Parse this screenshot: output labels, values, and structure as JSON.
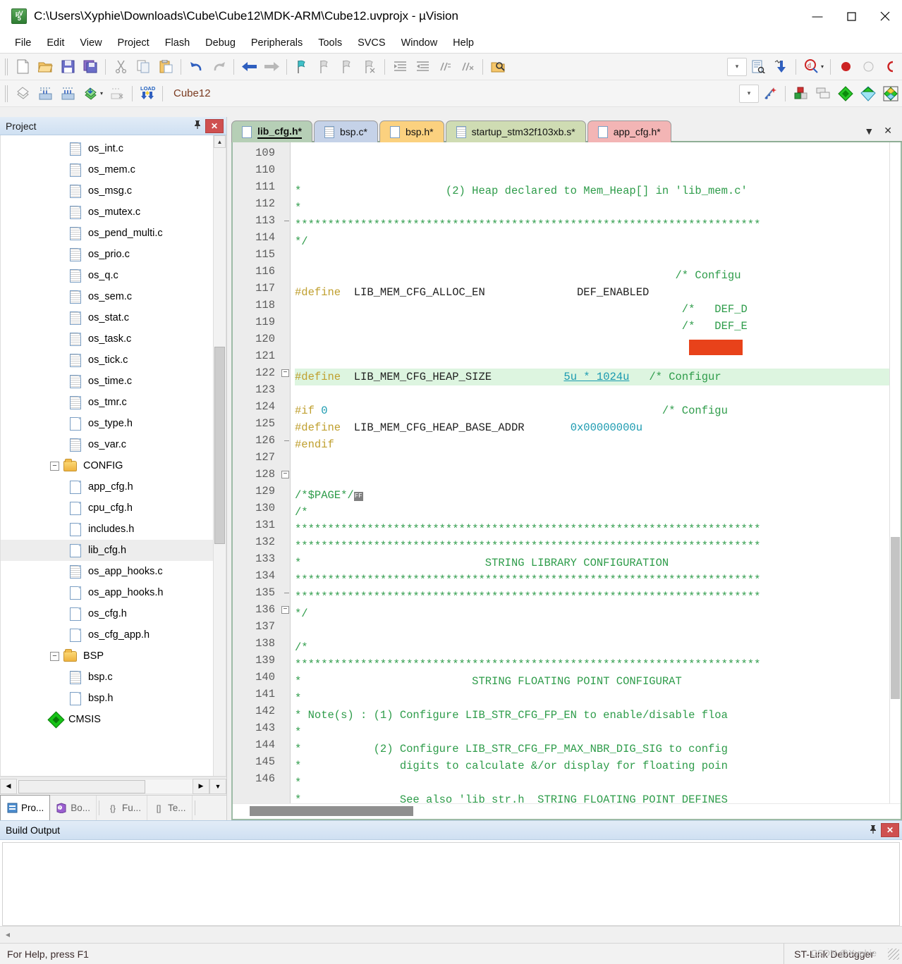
{
  "window": {
    "title": "C:\\Users\\Xyphie\\Downloads\\Cube\\Cube12\\MDK-ARM\\Cube12.uvprojx - µVision",
    "app_icon_top": "µV",
    "app_icon_bottom": "5",
    "minimize": "—",
    "maximize": "▢",
    "close": "✕"
  },
  "menu": {
    "items": [
      "File",
      "Edit",
      "View",
      "Project",
      "Flash",
      "Debug",
      "Peripherals",
      "Tools",
      "SVCS",
      "Window",
      "Help"
    ]
  },
  "toolbar1": {
    "buttons": [
      {
        "name": "new-file-icon",
        "glyph": "📄"
      },
      {
        "name": "open-file-icon",
        "glyph": "📂"
      },
      {
        "name": "save-icon",
        "glyph": "💾"
      },
      {
        "name": "save-all-icon",
        "glyph": "🗂"
      },
      {
        "name": "cut-icon",
        "glyph": "✂"
      },
      {
        "name": "copy-icon",
        "glyph": "⧉"
      },
      {
        "name": "paste-icon",
        "glyph": "📋"
      },
      {
        "name": "undo-icon",
        "glyph": "↶"
      },
      {
        "name": "redo-icon",
        "glyph": "↷"
      },
      {
        "name": "navigate-back-icon",
        "glyph": "←"
      },
      {
        "name": "navigate-forward-icon",
        "glyph": "→"
      },
      {
        "name": "bookmark-toggle-icon",
        "glyph": "⚑"
      },
      {
        "name": "bookmark-prev-icon",
        "glyph": "⚐"
      },
      {
        "name": "bookmark-next-icon",
        "glyph": "⚐"
      },
      {
        "name": "bookmark-clear-icon",
        "glyph": "⚐"
      },
      {
        "name": "indent-icon",
        "glyph": "⇥"
      },
      {
        "name": "outdent-icon",
        "glyph": "⇤"
      },
      {
        "name": "comment-icon",
        "glyph": "//"
      },
      {
        "name": "uncomment-icon",
        "glyph": "//"
      },
      {
        "name": "find-in-files-icon",
        "glyph": "🔍"
      }
    ],
    "right_buttons": [
      {
        "name": "configure-combo-icon",
        "glyph": "⌄"
      },
      {
        "name": "config-wizard-icon",
        "glyph": "📝"
      },
      {
        "name": "download-icon",
        "glyph": "⬇"
      },
      {
        "name": "debug-session-icon",
        "glyph": "Q"
      },
      {
        "name": "debug-dropdown-icon",
        "glyph": "▾"
      },
      {
        "name": "insert-breakpoint-icon",
        "glyph": "⬤"
      },
      {
        "name": "disable-breakpoint-icon",
        "glyph": "⬡"
      },
      {
        "name": "kill-breakpoints-icon",
        "glyph": "◖"
      }
    ]
  },
  "toolbar2": {
    "buttons": [
      {
        "name": "translate-icon",
        "glyph": "◈"
      },
      {
        "name": "build-icon",
        "glyph": "▥"
      },
      {
        "name": "rebuild-icon",
        "glyph": "▦"
      },
      {
        "name": "batch-build-icon",
        "glyph": "◆"
      },
      {
        "name": "batch-build-dropdown-icon",
        "glyph": "▾"
      },
      {
        "name": "stop-build-icon",
        "glyph": "▧"
      },
      {
        "name": "load-icon",
        "glyph": "LOAD"
      }
    ],
    "target_label": "Cube12",
    "right_buttons": [
      {
        "name": "target-options-icon",
        "glyph": "⌄"
      },
      {
        "name": "magic-wand-icon",
        "glyph": "✨"
      },
      {
        "name": "manage-project-items-icon",
        "glyph": "▣"
      },
      {
        "name": "multi-project-icon",
        "glyph": "❐"
      },
      {
        "name": "pack-installer-icon",
        "glyph": "◆"
      },
      {
        "name": "manage-rte-icon",
        "glyph": "◇"
      },
      {
        "name": "select-software-packs-icon",
        "glyph": "◈"
      }
    ]
  },
  "project_panel": {
    "title": "Project",
    "pin": "📌",
    "close": "✕",
    "tree": [
      {
        "label": "os_int.c",
        "indent": 3,
        "icon": "c-file",
        "selected": false,
        "expander": null
      },
      {
        "label": "os_mem.c",
        "indent": 3,
        "icon": "c-file",
        "selected": false,
        "expander": null
      },
      {
        "label": "os_msg.c",
        "indent": 3,
        "icon": "c-file",
        "selected": false,
        "expander": null
      },
      {
        "label": "os_mutex.c",
        "indent": 3,
        "icon": "c-file",
        "selected": false,
        "expander": null
      },
      {
        "label": "os_pend_multi.c",
        "indent": 3,
        "icon": "c-file",
        "selected": false,
        "expander": null
      },
      {
        "label": "os_prio.c",
        "indent": 3,
        "icon": "c-file",
        "selected": false,
        "expander": null
      },
      {
        "label": "os_q.c",
        "indent": 3,
        "icon": "c-file",
        "selected": false,
        "expander": null
      },
      {
        "label": "os_sem.c",
        "indent": 3,
        "icon": "c-file",
        "selected": false,
        "expander": null
      },
      {
        "label": "os_stat.c",
        "indent": 3,
        "icon": "c-file",
        "selected": false,
        "expander": null
      },
      {
        "label": "os_task.c",
        "indent": 3,
        "icon": "c-file",
        "selected": false,
        "expander": null
      },
      {
        "label": "os_tick.c",
        "indent": 3,
        "icon": "c-file",
        "selected": false,
        "expander": null
      },
      {
        "label": "os_time.c",
        "indent": 3,
        "icon": "c-file",
        "selected": false,
        "expander": null
      },
      {
        "label": "os_tmr.c",
        "indent": 3,
        "icon": "c-file",
        "selected": false,
        "expander": null
      },
      {
        "label": "os_type.h",
        "indent": 3,
        "icon": "h-file",
        "selected": false,
        "expander": null
      },
      {
        "label": "os_var.c",
        "indent": 3,
        "icon": "c-file",
        "selected": false,
        "expander": null
      },
      {
        "label": "CONFIG",
        "indent": 2,
        "icon": "folder",
        "selected": false,
        "expander": "−"
      },
      {
        "label": "app_cfg.h",
        "indent": 3,
        "icon": "h-file",
        "selected": false,
        "expander": null
      },
      {
        "label": "cpu_cfg.h",
        "indent": 3,
        "icon": "h-file",
        "selected": false,
        "expander": null
      },
      {
        "label": "includes.h",
        "indent": 3,
        "icon": "h-file",
        "selected": false,
        "expander": null
      },
      {
        "label": "lib_cfg.h",
        "indent": 3,
        "icon": "h-file",
        "selected": true,
        "expander": null
      },
      {
        "label": "os_app_hooks.c",
        "indent": 3,
        "icon": "c-file",
        "selected": false,
        "expander": null
      },
      {
        "label": "os_app_hooks.h",
        "indent": 3,
        "icon": "h-file",
        "selected": false,
        "expander": null
      },
      {
        "label": "os_cfg.h",
        "indent": 3,
        "icon": "h-file",
        "selected": false,
        "expander": null
      },
      {
        "label": "os_cfg_app.h",
        "indent": 3,
        "icon": "h-file",
        "selected": false,
        "expander": null
      },
      {
        "label": "BSP",
        "indent": 2,
        "icon": "folder",
        "selected": false,
        "expander": "−"
      },
      {
        "label": "bsp.c",
        "indent": 3,
        "icon": "c-file",
        "selected": false,
        "expander": null
      },
      {
        "label": "bsp.h",
        "indent": 3,
        "icon": "h-file",
        "selected": false,
        "expander": null
      },
      {
        "label": "CMSIS",
        "indent": 2,
        "icon": "cmsis",
        "selected": false,
        "expander": null
      }
    ],
    "bottom_tabs": [
      {
        "label": "Pro...",
        "icon": "project-icon",
        "active": true
      },
      {
        "label": "Bo...",
        "icon": "books-icon",
        "active": false
      },
      {
        "label": "Fu...",
        "icon": "functions-icon",
        "active": false,
        "prefix": "{}"
      },
      {
        "label": "Te...",
        "icon": "templates-icon",
        "active": false,
        "prefix": "[]"
      }
    ]
  },
  "editor": {
    "tabs": [
      {
        "label": "lib_cfg.h*",
        "color": "#b6cfb6",
        "active": true,
        "icon": "h-file"
      },
      {
        "label": "bsp.c*",
        "color": "#c5d2e8",
        "active": false,
        "icon": "c-file"
      },
      {
        "label": "bsp.h*",
        "color": "#fbd17f",
        "active": false,
        "icon": "h-file"
      },
      {
        "label": "startup_stm32f103xb.s*",
        "color": "#cfdcb3",
        "active": false,
        "icon": "c-file"
      },
      {
        "label": "app_cfg.h*",
        "color": "#f3b5b5",
        "active": false,
        "icon": "h-file"
      }
    ],
    "tab_menu_icon": "▼",
    "tab_close_icon": "✕",
    "first_line_number": 109,
    "lines": [
      {
        "n": 109,
        "fold": "",
        "highlight": false,
        "spans": [
          {
            "t": "*                      (2) Heap declared to Mem_Heap[] in 'lib_mem.c'",
            "c": "c-comment"
          }
        ]
      },
      {
        "n": 110,
        "fold": "",
        "highlight": false,
        "spans": [
          {
            "t": "*",
            "c": "c-comment"
          }
        ]
      },
      {
        "n": 111,
        "fold": "",
        "highlight": false,
        "spans": [
          {
            "t": "***********************************************************************",
            "c": "c-comment"
          }
        ]
      },
      {
        "n": 112,
        "fold": "",
        "highlight": false,
        "spans": [
          {
            "t": "*/",
            "c": "c-comment"
          }
        ]
      },
      {
        "n": 113,
        "fold": "dash",
        "highlight": false,
        "spans": []
      },
      {
        "n": 114,
        "fold": "",
        "highlight": false,
        "spans": [
          {
            "t": "                                                          /* Configu",
            "c": "c-comment"
          }
        ]
      },
      {
        "n": 115,
        "fold": "",
        "highlight": false,
        "spans": [
          {
            "t": "#define",
            "c": "c-pre"
          },
          {
            "t": "  LIB_MEM_CFG_ALLOC_EN              DEF_ENABLED",
            "c": "c-ident"
          }
        ]
      },
      {
        "n": 116,
        "fold": "",
        "highlight": false,
        "spans": [
          {
            "t": "                                                           /*   DEF_D",
            "c": "c-comment"
          }
        ]
      },
      {
        "n": 117,
        "fold": "",
        "highlight": false,
        "spans": [
          {
            "t": "                                                           /*   DEF_E",
            "c": "c-comment"
          }
        ]
      },
      {
        "n": 118,
        "fold": "",
        "highlight": false,
        "spans": []
      },
      {
        "n": 119,
        "fold": "",
        "highlight": false,
        "spans": []
      },
      {
        "n": 120,
        "fold": "",
        "highlight": true,
        "spans": [
          {
            "t": "#define",
            "c": "c-pre"
          },
          {
            "t": "  LIB_MEM_CFG_HEAP_SIZE           ",
            "c": "c-ident"
          },
          {
            "t": "5u * 1024u",
            "c": "c-numu"
          },
          {
            "t": "   ",
            "c": "c-ident"
          },
          {
            "t": "/* Configur",
            "c": "c-comment"
          }
        ]
      },
      {
        "n": 121,
        "fold": "",
        "highlight": false,
        "spans": []
      },
      {
        "n": 122,
        "fold": "minus",
        "highlight": false,
        "spans": [
          {
            "t": "#if",
            "c": "c-pre"
          },
          {
            "t": " 0",
            "c": "c-num"
          },
          {
            "t": "                                                   /* Configu",
            "c": "c-comment"
          }
        ]
      },
      {
        "n": 123,
        "fold": "",
        "highlight": false,
        "spans": [
          {
            "t": "#define",
            "c": "c-pre"
          },
          {
            "t": "  LIB_MEM_CFG_HEAP_BASE_ADDR       ",
            "c": "c-ident"
          },
          {
            "t": "0x00000000u",
            "c": "c-num"
          }
        ]
      },
      {
        "n": 124,
        "fold": "",
        "highlight": false,
        "spans": [
          {
            "t": "#endif",
            "c": "c-pre"
          }
        ]
      },
      {
        "n": 125,
        "fold": "",
        "highlight": false,
        "spans": []
      },
      {
        "n": 126,
        "fold": "dash",
        "highlight": false,
        "spans": []
      },
      {
        "n": 127,
        "fold": "",
        "highlight": false,
        "spans": [
          {
            "t": "/*$PAGE*/",
            "c": "c-comment"
          },
          {
            "t": "FF",
            "c": "ff"
          }
        ]
      },
      {
        "n": 128,
        "fold": "minus",
        "highlight": false,
        "spans": [
          {
            "t": "/*",
            "c": "c-comment"
          }
        ]
      },
      {
        "n": 129,
        "fold": "",
        "highlight": false,
        "spans": [
          {
            "t": "***********************************************************************",
            "c": "c-comment"
          }
        ]
      },
      {
        "n": 130,
        "fold": "",
        "highlight": false,
        "spans": [
          {
            "t": "***********************************************************************",
            "c": "c-comment"
          }
        ]
      },
      {
        "n": 131,
        "fold": "",
        "highlight": false,
        "spans": [
          {
            "t": "*                            STRING LIBRARY CONFIGURATION",
            "c": "c-comment"
          }
        ]
      },
      {
        "n": 132,
        "fold": "",
        "highlight": false,
        "spans": [
          {
            "t": "***********************************************************************",
            "c": "c-comment"
          }
        ]
      },
      {
        "n": 133,
        "fold": "",
        "highlight": false,
        "spans": [
          {
            "t": "***********************************************************************",
            "c": "c-comment"
          }
        ]
      },
      {
        "n": 134,
        "fold": "",
        "highlight": false,
        "spans": [
          {
            "t": "*/",
            "c": "c-comment"
          }
        ]
      },
      {
        "n": 135,
        "fold": "dash",
        "highlight": false,
        "spans": []
      },
      {
        "n": 136,
        "fold": "minus",
        "highlight": false,
        "spans": [
          {
            "t": "/*",
            "c": "c-comment"
          }
        ]
      },
      {
        "n": 137,
        "fold": "",
        "highlight": false,
        "spans": [
          {
            "t": "***********************************************************************",
            "c": "c-comment"
          }
        ]
      },
      {
        "n": 138,
        "fold": "",
        "highlight": false,
        "spans": [
          {
            "t": "*                          STRING FLOATING POINT CONFIGURAT",
            "c": "c-comment"
          }
        ]
      },
      {
        "n": 139,
        "fold": "",
        "highlight": false,
        "spans": [
          {
            "t": "*",
            "c": "c-comment"
          }
        ]
      },
      {
        "n": 140,
        "fold": "",
        "highlight": false,
        "spans": [
          {
            "t": "* Note(s) : (1) Configure LIB_STR_CFG_FP_EN to enable/disable floa",
            "c": "c-comment"
          }
        ]
      },
      {
        "n": 141,
        "fold": "",
        "highlight": false,
        "spans": [
          {
            "t": "*",
            "c": "c-comment"
          }
        ]
      },
      {
        "n": 142,
        "fold": "",
        "highlight": false,
        "spans": [
          {
            "t": "*           (2) Configure LIB_STR_CFG_FP_MAX_NBR_DIG_SIG to config",
            "c": "c-comment"
          }
        ]
      },
      {
        "n": 143,
        "fold": "",
        "highlight": false,
        "spans": [
          {
            "t": "*               digits to calculate &/or display for floating poin",
            "c": "c-comment"
          }
        ]
      },
      {
        "n": 144,
        "fold": "",
        "highlight": false,
        "spans": [
          {
            "t": "*",
            "c": "c-comment"
          }
        ]
      },
      {
        "n": 145,
        "fold": "",
        "highlight": false,
        "spans": [
          {
            "t": "*               See also 'lib_str.h  STRING FLOATING POINT DEFINES",
            "c": "c-comment"
          }
        ]
      },
      {
        "n": 146,
        "fold": "",
        "highlight": false,
        "spans": [
          {
            "t": "***********************************************************************",
            "c": "c-comment"
          }
        ]
      }
    ],
    "annotation_color": "#e8421a",
    "highlight_color": "#ddf5e0"
  },
  "build_output": {
    "title": "Build Output",
    "pin": "📌",
    "close": "✕",
    "content": ""
  },
  "status_bar": {
    "help_text": "For Help, press F1",
    "debugger": "ST-Link Debugger",
    "watermark": "CSDN @Xyphie"
  }
}
